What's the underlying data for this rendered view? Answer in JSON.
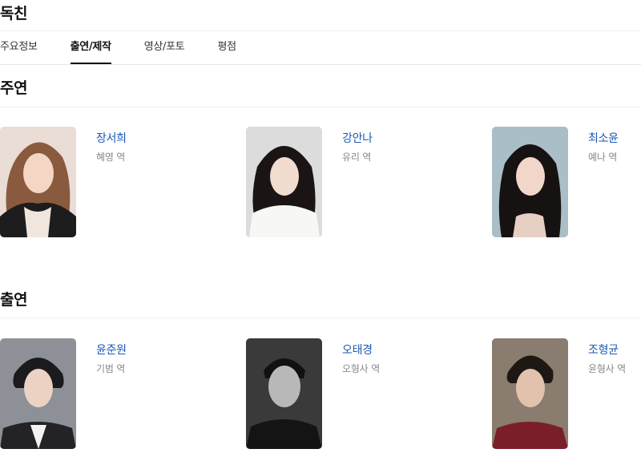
{
  "page_title": "독친",
  "tabs": [
    {
      "label": "주요정보",
      "active": false
    },
    {
      "label": "출연/제작",
      "active": true
    },
    {
      "label": "영상/포토",
      "active": false
    },
    {
      "label": "평점",
      "active": false
    }
  ],
  "sections": [
    {
      "title": "주연",
      "cast": [
        {
          "name": "장서희",
          "role": "혜영 역"
        },
        {
          "name": "강안나",
          "role": "유리 역"
        },
        {
          "name": "최소윤",
          "role": "예나 역"
        }
      ]
    },
    {
      "title": "출연",
      "cast": [
        {
          "name": "윤준원",
          "role": "기범 역"
        },
        {
          "name": "오태경",
          "role": "오형사 역"
        },
        {
          "name": "조형균",
          "role": "윤형사 역"
        }
      ]
    }
  ],
  "colors": {
    "link": "#1a5ab7",
    "role": "#888888",
    "divider": "#e6e6e6"
  }
}
